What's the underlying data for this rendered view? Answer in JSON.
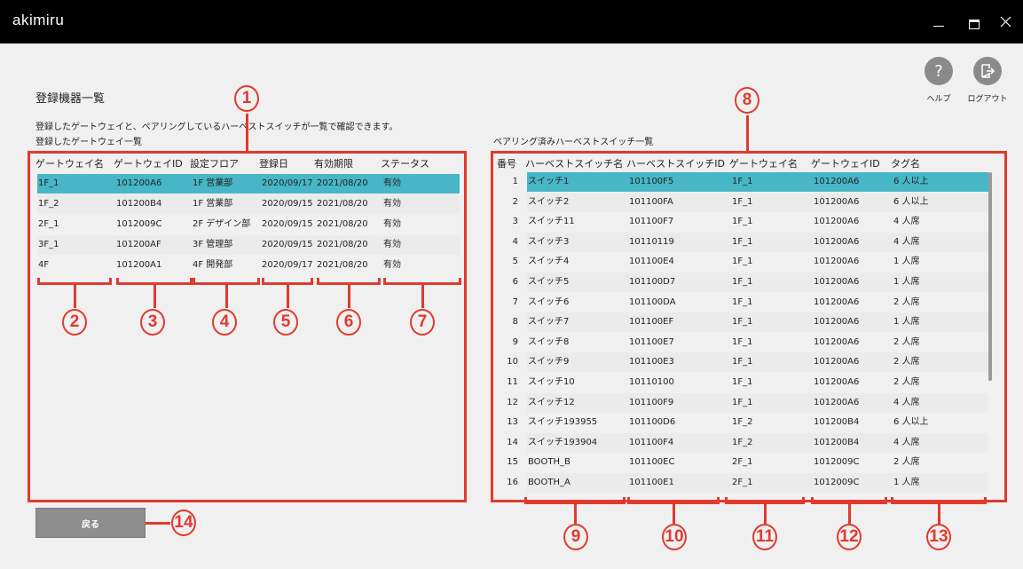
{
  "app": {
    "title": "akimiru"
  },
  "header": {
    "page_title": "登録機器一覧",
    "description": "登録したゲートウェイと、ペアリングしているハーベストスイッチが一覧で確認できます。",
    "help_label": "ヘルプ",
    "logout_label": "ログアウト",
    "help_icon": "question-mark",
    "logout_icon": "logout-door"
  },
  "gateway_list": {
    "title": "登録したゲートウェイ一覧",
    "columns": [
      "ゲートウェイ名",
      "ゲートウェイID",
      "設定フロア",
      "登録日",
      "有効期限",
      "ステータス"
    ],
    "rows": [
      [
        "1F_1",
        "101200A6",
        "1F 営業部",
        "2020/09/17",
        "2021/08/20",
        "有効"
      ],
      [
        "1F_2",
        "101200B4",
        "1F 営業部",
        "2020/09/15",
        "2021/08/20",
        "有効"
      ],
      [
        "2F_1",
        "1012009C",
        "2F デザイン部",
        "2020/09/15",
        "2021/08/20",
        "有効"
      ],
      [
        "3F_1",
        "101200AF",
        "3F 管理部",
        "2020/09/15",
        "2021/08/20",
        "有効"
      ],
      [
        "4F",
        "101200A1",
        "4F 開発部",
        "2020/09/17",
        "2021/08/20",
        "有効"
      ]
    ]
  },
  "switch_list": {
    "title": "ペアリング済みハーベストスイッチ一覧",
    "columns": [
      "番号",
      "ハーベストスイッチ名",
      "ハーベストスイッチID",
      "ゲートウェイ名",
      "ゲートウェイID",
      "タグ名"
    ],
    "rows": [
      [
        "1",
        "スイッチ1",
        "101100F5",
        "1F_1",
        "101200A6",
        "6 人以上"
      ],
      [
        "2",
        "スイッチ2",
        "101100FA",
        "1F_1",
        "101200A6",
        "6 人以上"
      ],
      [
        "3",
        "スイッチ11",
        "101100F7",
        "1F_1",
        "101200A6",
        "4 人席"
      ],
      [
        "4",
        "スイッチ3",
        "10110119",
        "1F_1",
        "101200A6",
        "4 人席"
      ],
      [
        "5",
        "スイッチ4",
        "101100E4",
        "1F_1",
        "101200A6",
        "1 人席"
      ],
      [
        "6",
        "スイッチ5",
        "101100D7",
        "1F_1",
        "101200A6",
        "1 人席"
      ],
      [
        "7",
        "スイッチ6",
        "101100DA",
        "1F_1",
        "101200A6",
        "2 人席"
      ],
      [
        "8",
        "スイッチ7",
        "101100EF",
        "1F_1",
        "101200A6",
        "1 人席"
      ],
      [
        "9",
        "スイッチ8",
        "101100E7",
        "1F_1",
        "101200A6",
        "2 人席"
      ],
      [
        "10",
        "スイッチ9",
        "101100E3",
        "1F_1",
        "101200A6",
        "2 人席"
      ],
      [
        "11",
        "スイッチ10",
        "10110100",
        "1F_1",
        "101200A6",
        "2 人席"
      ],
      [
        "12",
        "スイッチ12",
        "101100F9",
        "1F_1",
        "101200A6",
        "4 人席"
      ],
      [
        "13",
        "スイッチ193955",
        "101100D6",
        "1F_2",
        "101200B4",
        "6 人以上"
      ],
      [
        "14",
        "スイッチ193904",
        "101100F4",
        "1F_2",
        "101200B4",
        "4 人席"
      ],
      [
        "15",
        "BOOTH_B",
        "101100EC",
        "2F_1",
        "1012009C",
        "2 人席"
      ],
      [
        "16",
        "BOOTH_A",
        "101100E1",
        "2F_1",
        "1012009C",
        "1 人席"
      ]
    ]
  },
  "footer": {
    "back_label": "戻る"
  },
  "annotations": [
    "1",
    "2",
    "3",
    "4",
    "5",
    "6",
    "7",
    "8",
    "9",
    "10",
    "11",
    "12",
    "13",
    "14"
  ],
  "colors": {
    "selected_row": "#47b6c7",
    "annotation_red": "#e03a2e",
    "titlebar": "#000000"
  }
}
